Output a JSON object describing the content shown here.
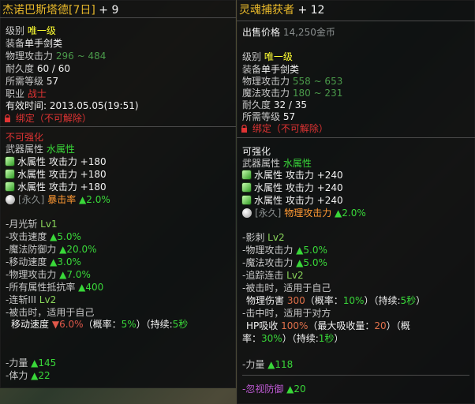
{
  "left": {
    "title_name": "杰诺巴斯塔德[7日]",
    "title_plus": "+ 9",
    "level_label": "级别",
    "level_value": "唯一级",
    "equip_label": "装备",
    "equip_value": "单手剑类",
    "patk_label": "物理攻击力",
    "patk_value": "296 ~ 484",
    "dur_label": "耐久度",
    "dur_value": "60 / 60",
    "req_label": "所需等级",
    "req_value": "57",
    "job_label": "职业",
    "job_value": "战士",
    "expiry_label": "有效时间:",
    "expiry_value": "2013.05.05(19:51)",
    "bind": "绑定（不可解除）",
    "no_enhance": "不可强化",
    "weapon_attr_label": "武器属性",
    "weapon_attr_value": "水属性",
    "gems": [
      {
        "label": "水属性 攻击力",
        "value": "+180"
      },
      {
        "label": "水属性 攻击力",
        "value": "+180"
      },
      {
        "label": "水属性 攻击力",
        "value": "+180"
      }
    ],
    "perm_tag": "[永久]",
    "perm_stat": "暴击率",
    "perm_value": "▲2.0%",
    "skill1_name": "-月光斩",
    "skill1_lv": "Lv1",
    "stat_lines": [
      {
        "label": "-攻击速度",
        "value": "▲5.0%"
      },
      {
        "label": "-魔法防御力",
        "value": "▲20.0%"
      },
      {
        "label": "-移动速度",
        "value": "▲3.0%"
      },
      {
        "label": "-物理攻击力",
        "value": "▲7.0%"
      },
      {
        "label": "-所有属性抵抗率",
        "value": "▲400"
      }
    ],
    "skill2_name": "-连斩III",
    "skill2_lv": "Lv2",
    "proc_desc": "-被击时，适用于自己",
    "proc_stat": "移动速度",
    "proc_value": "▼6.0%",
    "proc_chance_label": "（概率：",
    "proc_chance": "5%",
    "proc_dur_label": "）（持续:",
    "proc_dur": "5秒",
    "bottom_stats": [
      {
        "label": "-力量",
        "value": "▲145"
      },
      {
        "label": "-体力",
        "value": "▲22"
      }
    ]
  },
  "right": {
    "title_name": "灵魂捕获者",
    "title_plus": "+ 12",
    "price_label": "出售价格",
    "price_value": "14,250金币",
    "level_label": "级别",
    "level_value": "唯一级",
    "equip_label": "装备",
    "equip_value": "单手剑类",
    "patk_label": "物理攻击力",
    "patk_value": "558 ~ 653",
    "matk_label": "魔法攻击力",
    "matk_value": "180 ~ 231",
    "dur_label": "耐久度",
    "dur_value": "32 / 35",
    "req_label": "所需等级",
    "req_value": "57",
    "bind": "绑定（不可解除）",
    "enhance": "可强化",
    "weapon_attr_label": "武器属性",
    "weapon_attr_value": "水属性",
    "gems": [
      {
        "label": "水属性 攻击力",
        "value": "+240"
      },
      {
        "label": "水属性 攻击力",
        "value": "+240"
      },
      {
        "label": "水属性 攻击力",
        "value": "+240"
      }
    ],
    "perm_tag": "[永久]",
    "perm_stat": "物理攻击力",
    "perm_value": "▲2.0%",
    "skill1_name": "-影刺",
    "skill1_lv": "Lv2",
    "stat_lines": [
      {
        "label": "-物理攻击力",
        "value": "▲5.0%"
      },
      {
        "label": "-魔法攻击力",
        "value": "▲5.0%"
      }
    ],
    "skill2_name": "-追踪连击",
    "skill2_lv": "Lv2",
    "proc1_desc": "-被击时，适用于自己",
    "proc1_stat": "物理伤害",
    "proc1_value": "300",
    "proc1_chance_label": "（概率：",
    "proc1_chance": "10%",
    "proc1_dur_label": "）（持续:",
    "proc1_dur": "5秒",
    "proc1_end": "）",
    "proc2_desc": "-击中时，适用于对方",
    "proc2_stat": "HP吸收",
    "proc2_value": "100%",
    "proc2_cap_label": "（最大吸收量：",
    "proc2_cap": "20",
    "proc2_chance_prefix": "）（概",
    "proc2_chance_label": "率：",
    "proc2_chance": "30%",
    "proc2_dur_label": "）（持续:",
    "proc2_dur": "1秒",
    "proc2_end": "）",
    "str_label": "-力量",
    "str_value": "▲118",
    "ignore_label": "-忽视防御",
    "ignore_value": "▲20"
  }
}
